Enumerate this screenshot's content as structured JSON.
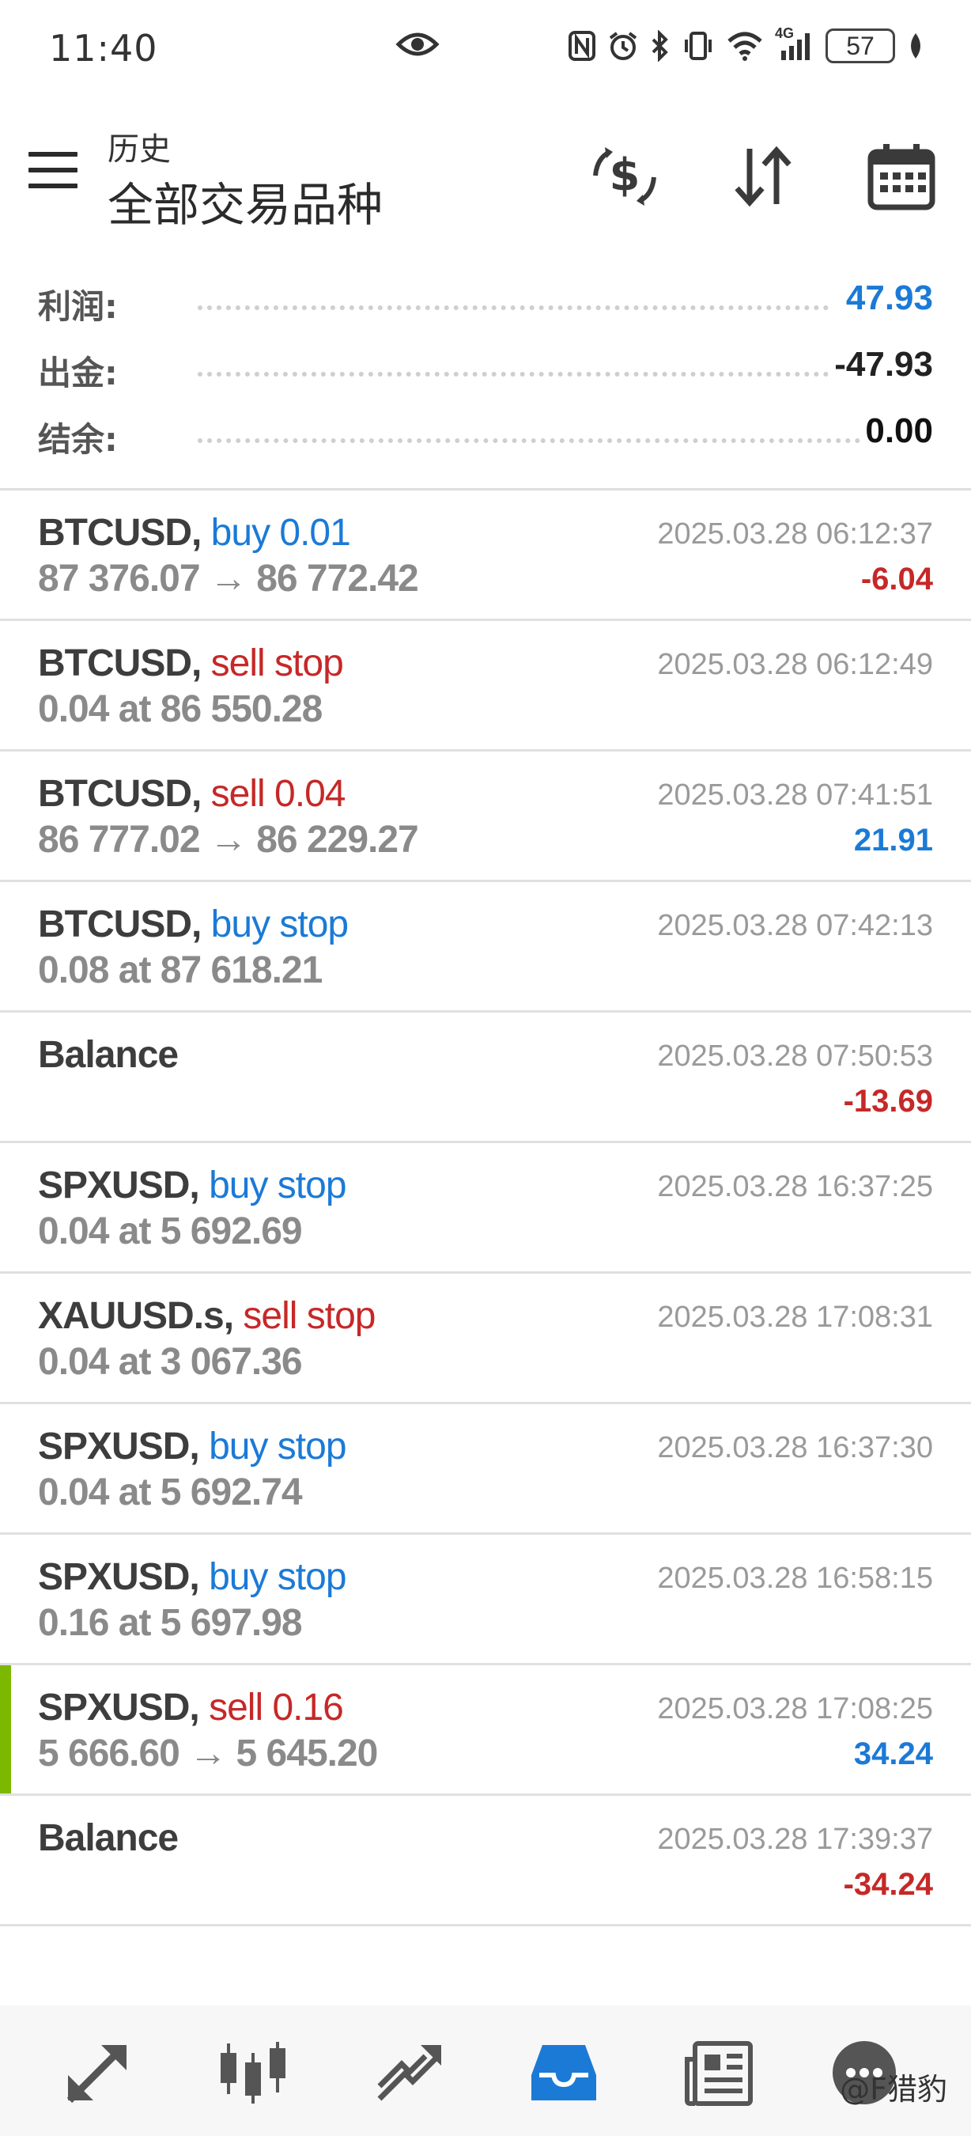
{
  "status_bar": {
    "time": "11:40",
    "battery": "57",
    "signal_label": "4G"
  },
  "app_bar": {
    "subtitle": "历史",
    "title": "全部交易品种",
    "icons": [
      "menu-icon",
      "dollar-refresh-icon",
      "sort-icon",
      "calendar-icon"
    ]
  },
  "summary": {
    "profit_label": "利润:",
    "profit_value": "47.93",
    "withdraw_label": "出金:",
    "withdraw_value": "-47.93",
    "balance_label": "结余:",
    "balance_value": "0.00"
  },
  "colors": {
    "buy": "#1b7ad6",
    "sell": "#c62828",
    "marker": "#7db800"
  },
  "history": [
    {
      "symbol": "BTCUSD,",
      "action": "buy 0.01",
      "side": "buy",
      "detail": "87 376.07 → 86 772.42",
      "time": "2025.03.28 06:12:37",
      "profit": "-6.04",
      "profit_sign": "neg"
    },
    {
      "symbol": "BTCUSD,",
      "action": "sell stop",
      "side": "sell",
      "detail": "0.04 at 86 550.28",
      "time": "2025.03.28 06:12:49",
      "profit": "",
      "profit_sign": ""
    },
    {
      "symbol": "BTCUSD,",
      "action": "sell 0.04",
      "side": "sell",
      "detail": "86 777.02 → 86 229.27",
      "time": "2025.03.28 07:41:51",
      "profit": "21.91",
      "profit_sign": "pos"
    },
    {
      "symbol": "BTCUSD,",
      "action": "buy stop",
      "side": "buy",
      "detail": "0.08 at 87 618.21",
      "time": "2025.03.28 07:42:13",
      "profit": "",
      "profit_sign": ""
    },
    {
      "symbol": "Balance",
      "action": "",
      "side": "",
      "detail": "",
      "time": "2025.03.28 07:50:53",
      "profit": "-13.69",
      "profit_sign": "neg"
    },
    {
      "symbol": "SPXUSD,",
      "action": "buy stop",
      "side": "buy",
      "detail": "0.04 at 5 692.69",
      "time": "2025.03.28 16:37:25",
      "profit": "",
      "profit_sign": ""
    },
    {
      "symbol": "XAUUSD.s,",
      "action": "sell stop",
      "side": "sell",
      "detail": "0.04 at 3 067.36",
      "time": "2025.03.28 17:08:31",
      "profit": "",
      "profit_sign": ""
    },
    {
      "symbol": "SPXUSD,",
      "action": "buy stop",
      "side": "buy",
      "detail": "0.04 at 5 692.74",
      "time": "2025.03.28 16:37:30",
      "profit": "",
      "profit_sign": ""
    },
    {
      "symbol": "SPXUSD,",
      "action": "buy stop",
      "side": "buy",
      "detail": "0.16 at 5 697.98",
      "time": "2025.03.28 16:58:15",
      "profit": "",
      "profit_sign": ""
    },
    {
      "symbol": "SPXUSD,",
      "action": "sell 0.16",
      "side": "sell",
      "detail": "5 666.60 → 5 645.20",
      "time": "2025.03.28 17:08:25",
      "profit": "34.24",
      "profit_sign": "pos",
      "marked": true
    },
    {
      "symbol": "Balance",
      "action": "",
      "side": "",
      "detail": "",
      "time": "2025.03.28 17:39:37",
      "profit": "-34.24",
      "profit_sign": "neg"
    }
  ],
  "bottom_nav": {
    "items": [
      "quotes-icon",
      "chart-icon",
      "trade-icon",
      "history-icon",
      "news-icon",
      "messages-icon"
    ],
    "active": "history-icon"
  },
  "watermark": "@F猎豹"
}
